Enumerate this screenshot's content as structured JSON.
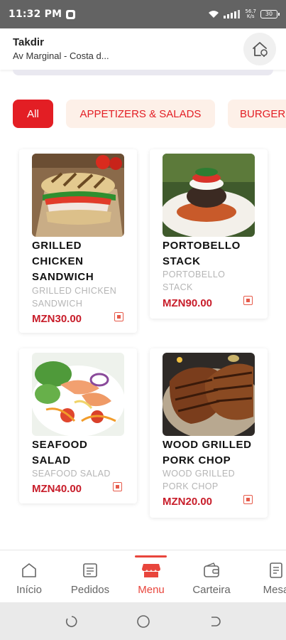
{
  "status_bar": {
    "time": "11:32 PM",
    "speed_top": "56.7",
    "speed_bottom": "K/s",
    "battery": "30"
  },
  "header": {
    "name": "Takdir",
    "address": "Av Marginal - Costa d..."
  },
  "categories": [
    {
      "label": "All",
      "active": true
    },
    {
      "label": "APPETIZERS & SALADS",
      "active": false
    },
    {
      "label": "BURGERS",
      "active": false
    }
  ],
  "products": [
    {
      "title_lines": [
        "GRILLED",
        "CHICKEN",
        "SANDWICH"
      ],
      "desc_lines": [
        "GRILLED CHICKEN",
        "SANDWICH"
      ],
      "price": "MZN30.00",
      "image": "grilled-chicken-sandwich"
    },
    {
      "title_lines": [
        "PORTOBELLO",
        "STACK"
      ],
      "desc_lines": [
        "PORTOBELLO",
        "STACK"
      ],
      "price": "MZN90.00",
      "image": "portobello-stack"
    },
    {
      "title_lines": [
        "SEAFOOD",
        "SALAD"
      ],
      "desc_lines": [
        "SEAFOOD SALAD"
      ],
      "price": "MZN40.00",
      "image": "seafood-salad"
    },
    {
      "title_lines": [
        "WOOD GRILLED",
        "PORK CHOP"
      ],
      "desc_lines": [
        "WOOD GRILLED",
        "PORK CHOP"
      ],
      "price": "MZN20.00",
      "image": "wood-grilled-pork-chop"
    }
  ],
  "bottom_nav": [
    {
      "label": "Início",
      "icon": "home-icon",
      "active": false
    },
    {
      "label": "Pedidos",
      "icon": "orders-icon",
      "active": false
    },
    {
      "label": "Menu",
      "icon": "menu-store-icon",
      "active": true
    },
    {
      "label": "Carteira",
      "icon": "wallet-icon",
      "active": false
    },
    {
      "label": "Mesa",
      "icon": "table-icon",
      "active": false
    }
  ],
  "colors": {
    "accent": "#e31e24",
    "price": "#c81d2a",
    "chip_bg": "#fdf0e8",
    "nav_active": "#e8453c"
  }
}
